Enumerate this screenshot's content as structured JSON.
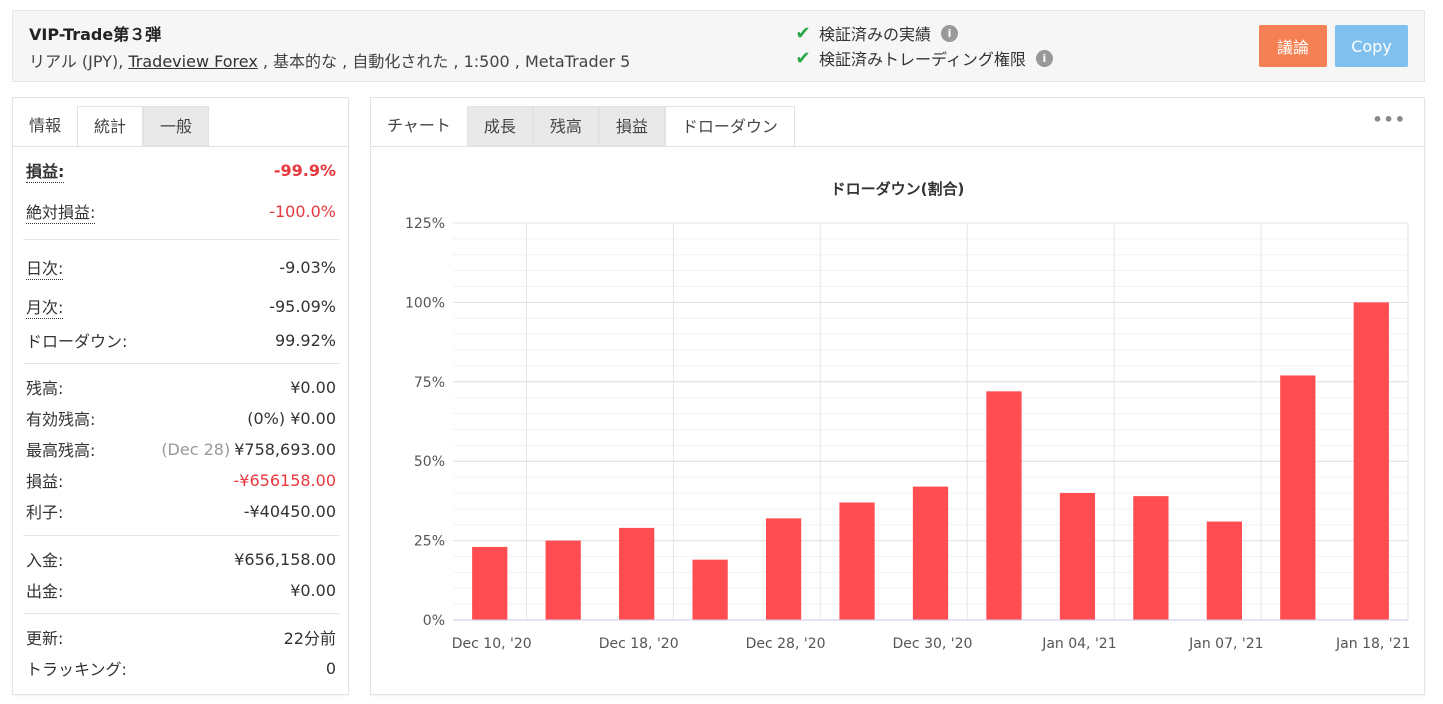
{
  "header": {
    "title": "VIP-Trade第３弾",
    "sub_prefix": "リアル (JPY), ",
    "broker": "Tradeview Forex",
    "sub_suffix": " , 基本的な , 自動化された , 1:500 , MetaTrader 5",
    "verified_track": "検証済みの実績",
    "verified_trading": "検証済みトレーディング権限",
    "discuss_label": "議論",
    "copy_label": "Copy"
  },
  "left_tabs": [
    "情報",
    "統計",
    "一般"
  ],
  "stats": {
    "gain_label": "損益:",
    "gain_value": "-99.9%",
    "abs_gain_label": "絶対損益:",
    "abs_gain_value": "-100.0%",
    "daily_label": "日次:",
    "daily_value": "-9.03%",
    "monthly_label": "月次:",
    "monthly_value": "-95.09%",
    "drawdown_label": "ドローダウン:",
    "drawdown_value": "99.92%",
    "balance_label": "残高:",
    "balance_value": "¥0.00",
    "equity_label": "有効残高:",
    "equity_note": "(0%)",
    "equity_value": "¥0.00",
    "highest_label": "最高残高:",
    "highest_note": "(Dec 28)",
    "highest_value": "¥758,693.00",
    "profit_label": "損益:",
    "profit_value": "-¥656158.00",
    "interest_label": "利子:",
    "interest_value": "-¥40450.00",
    "deposits_label": "入金:",
    "deposits_value": "¥656,158.00",
    "withdrawals_label": "出金:",
    "withdrawals_value": "¥0.00",
    "updated_label": "更新:",
    "updated_value": "22分前",
    "tracking_label": "トラッキング:",
    "tracking_value": "0"
  },
  "right_tabs": [
    "チャート",
    "成長",
    "残高",
    "損益",
    "ドローダウン"
  ],
  "more_label": "•••",
  "colors": {
    "bar": "#ff4d51",
    "red_text": "#e8383d",
    "check": "#28a745",
    "discuss": "#f58053",
    "copy": "#7fc0ee"
  },
  "chart_data": {
    "type": "bar",
    "title": "ドローダウン(割合)",
    "x_tick_labels": [
      "Dec 10, '20",
      "Dec 18, '20",
      "Dec 28, '20",
      "Dec 30, '20",
      "Jan 04, '21",
      "Jan 07, '21",
      "Jan 18, '21"
    ],
    "y_tick_labels": [
      "0%",
      "25%",
      "50%",
      "75%",
      "100%",
      "125%"
    ],
    "ylim": [
      0,
      125
    ],
    "values": [
      23,
      25,
      29,
      19,
      32,
      37,
      42,
      72,
      40,
      39,
      31,
      77,
      100
    ],
    "grid": true,
    "legend": "none"
  }
}
